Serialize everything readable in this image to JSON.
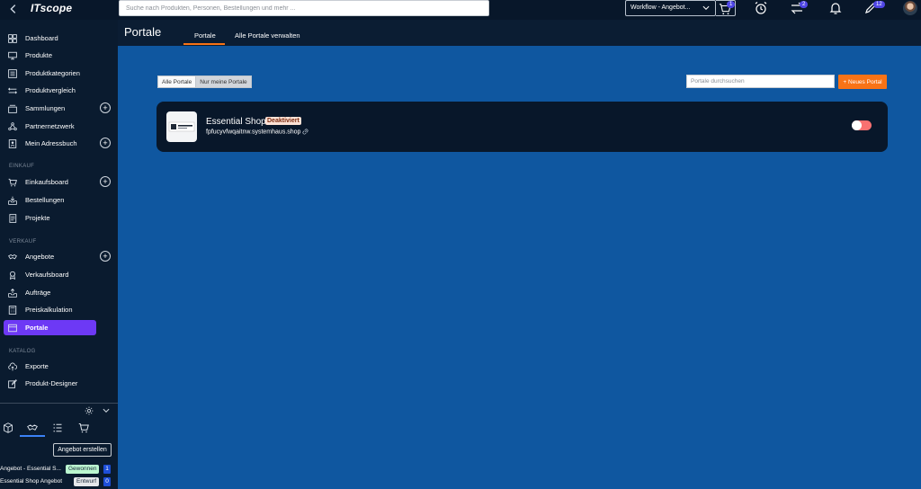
{
  "topbar": {
    "logo": "ITscope",
    "search_placeholder": "Suche nach Produkten, Personen, Bestellungen und mehr ...",
    "workflow_label": "Workflow - Angebot...",
    "cart_badge": "1",
    "transfer_badge": "2",
    "tasks_badge": "12"
  },
  "sidebar": {
    "items_main": [
      {
        "label": "Dashboard",
        "icon": "dashboard-icon"
      },
      {
        "label": "Produkte",
        "icon": "monitor-icon"
      },
      {
        "label": "Produktkategorien",
        "icon": "list-icon"
      },
      {
        "label": "Produktvergleich",
        "icon": "compare-icon"
      },
      {
        "label": "Sammlungen",
        "icon": "collection-icon"
      },
      {
        "label": "Partnernetzwerk",
        "icon": "network-icon"
      },
      {
        "label": "Mein Adressbuch",
        "icon": "addressbook-icon"
      }
    ],
    "section_einkauf": "EINKAUF",
    "items_einkauf": [
      {
        "label": "Einkaufsboard",
        "icon": "cart-icon"
      },
      {
        "label": "Bestellungen",
        "icon": "inbox-icon"
      },
      {
        "label": "Projekte",
        "icon": "project-icon"
      }
    ],
    "section_verkauf": "VERKAUF",
    "items_verkauf": [
      {
        "label": "Angebote",
        "icon": "handshake-icon"
      },
      {
        "label": "Verkaufsboard",
        "icon": "badge-icon"
      },
      {
        "label": "Aufträge",
        "icon": "orders-icon"
      },
      {
        "label": "Preiskalkulation",
        "icon": "calculator-icon"
      },
      {
        "label": "Portale",
        "icon": "portal-icon"
      }
    ],
    "section_katalog": "KATALOG",
    "items_katalog": [
      {
        "label": "Exporte",
        "icon": "cloud-upload-icon"
      },
      {
        "label": "Produkt-Designer",
        "icon": "edit-icon"
      }
    ],
    "create_offer_label": "Angebot erstellen",
    "offers": [
      {
        "name": "Angebot - Essential S...",
        "status": "Gewonnen",
        "status_color": "#bbf7d0",
        "count": "1"
      },
      {
        "name": "Essential Shop Angebot",
        "status": "Entwurf",
        "status_color": "#e5e7eb",
        "count": "0"
      }
    ]
  },
  "header": {
    "title": "Portale",
    "tabs": [
      {
        "label": "Portale",
        "active": true
      },
      {
        "label": "Alle Portale verwalten",
        "active": false
      }
    ]
  },
  "main": {
    "filters": [
      {
        "label": "Alle Portale",
        "active": true
      },
      {
        "label": "Nur meine Portale",
        "active": false
      }
    ],
    "search_placeholder": "Portale durchsuchen",
    "new_portal_label": "+ Neues Portal",
    "portals": [
      {
        "name": "Essential Shop",
        "status": "Deaktiviert",
        "url": "fpfucyvfwqaitnw.systemhaus.shop",
        "enabled": false
      }
    ]
  },
  "colors": {
    "accent_active": "#6d39f5",
    "primary_orange": "#f97316",
    "main_bg": "#0f57a0",
    "sidebar_bg": "#0a1b2f"
  }
}
